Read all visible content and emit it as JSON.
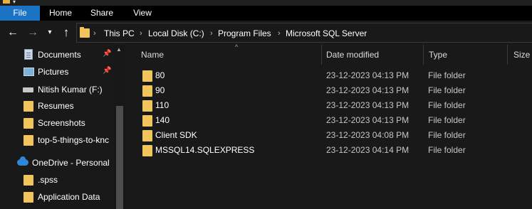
{
  "ribbon": {
    "tabs": [
      "File",
      "Home",
      "Share",
      "View"
    ]
  },
  "nav": {
    "back_icon": "back-arrow-icon",
    "forward_icon": "forward-arrow-icon",
    "recent_icon": "chevron-down-icon",
    "up_icon": "up-arrow-icon"
  },
  "address": {
    "crumbs": [
      "This PC",
      "Local Disk (C:)",
      "Program Files",
      "Microsoft SQL Server"
    ]
  },
  "sidebar": {
    "items": [
      {
        "label": "Documents",
        "icon": "documents-icon",
        "pinned": true
      },
      {
        "label": "Pictures",
        "icon": "pictures-icon",
        "pinned": true
      },
      {
        "label": "Nitish Kumar (F:)",
        "icon": "drive-icon",
        "pinned": false
      },
      {
        "label": "Resumes",
        "icon": "folder-icon",
        "pinned": false
      },
      {
        "label": "Screenshots",
        "icon": "folder-icon",
        "pinned": false
      },
      {
        "label": "top-5-things-to-knc",
        "icon": "folder-icon",
        "pinned": false
      },
      {
        "label": "OneDrive - Personal",
        "icon": "onedrive-cloud-icon",
        "pinned": false
      },
      {
        "label": ".spss",
        "icon": "folder-icon",
        "pinned": false
      },
      {
        "label": "Application Data",
        "icon": "folder-icon",
        "pinned": false
      }
    ]
  },
  "columns": {
    "name": "Name",
    "date_modified": "Date modified",
    "type": "Type",
    "size": "Size"
  },
  "files": [
    {
      "name": "80",
      "date": "23-12-2023 04:13 PM",
      "type": "File folder"
    },
    {
      "name": "90",
      "date": "23-12-2023 04:13 PM",
      "type": "File folder"
    },
    {
      "name": "110",
      "date": "23-12-2023 04:13 PM",
      "type": "File folder"
    },
    {
      "name": "140",
      "date": "23-12-2023 04:13 PM",
      "type": "File folder"
    },
    {
      "name": "Client SDK",
      "date": "23-12-2023 04:08 PM",
      "type": "File folder"
    },
    {
      "name": "MSSQL14.SQLEXPRESS",
      "date": "23-12-2023 04:14 PM",
      "type": "File folder"
    }
  ],
  "colors": {
    "accent": "#1a73c5",
    "background": "#191919",
    "folder": "#f2c55c"
  }
}
